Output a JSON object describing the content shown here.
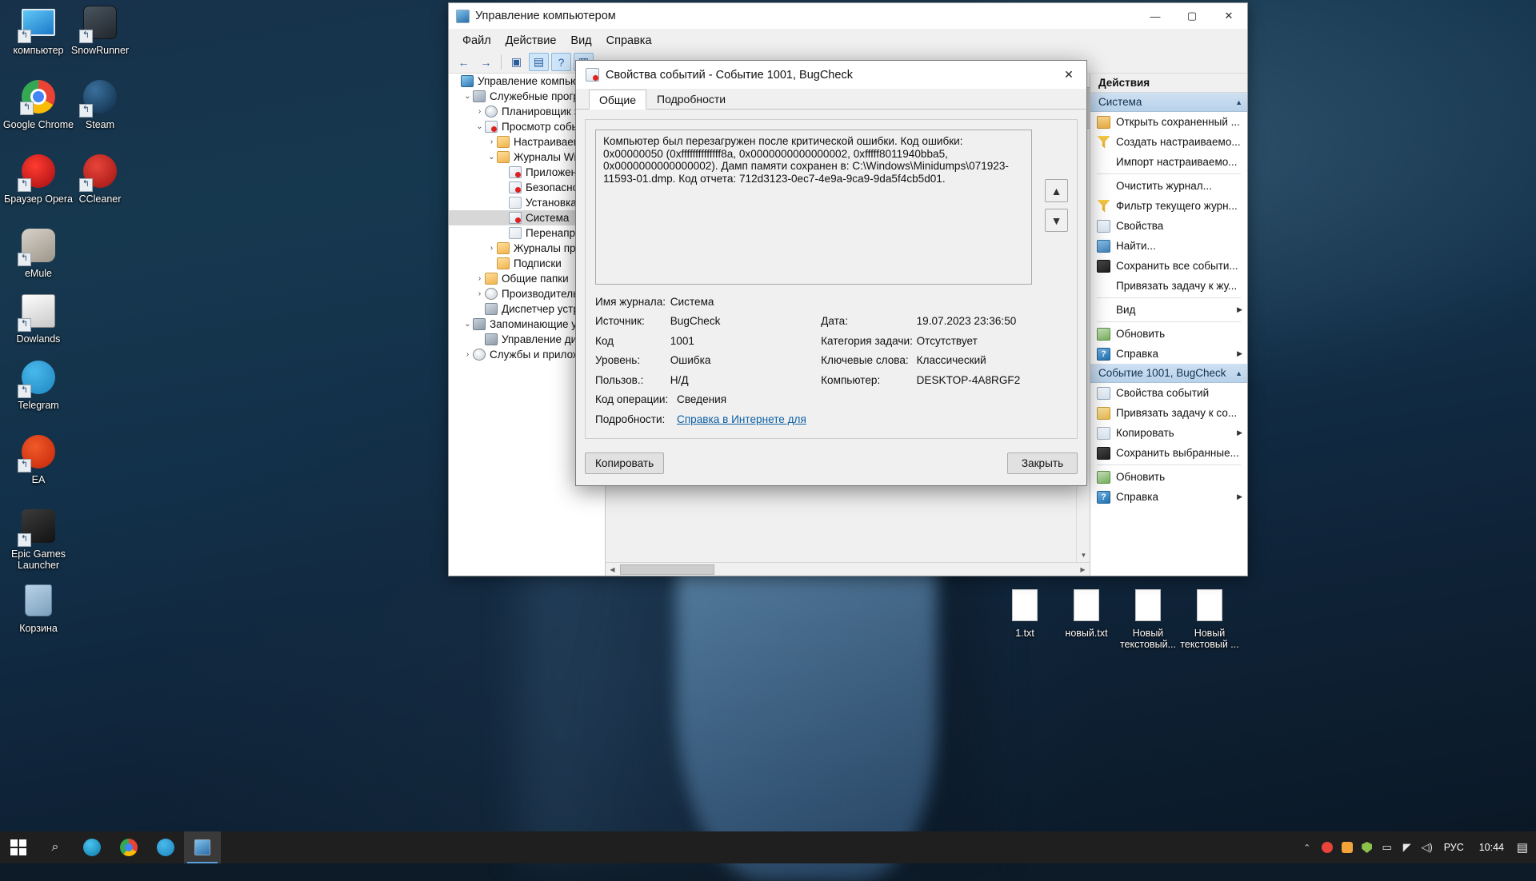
{
  "desktop": {
    "icons": [
      {
        "label": "компьютер",
        "icon": "computer-icon",
        "col": 0,
        "row": 0
      },
      {
        "label": "SnowRunner",
        "icon": "snowrunner-icon",
        "col": 1,
        "row": 0
      },
      {
        "label": "Google Chrome",
        "icon": "chrome-icon",
        "col": 0,
        "row": 1
      },
      {
        "label": "Steam",
        "icon": "steam-icon",
        "col": 1,
        "row": 1
      },
      {
        "label": "Браузер Opera",
        "icon": "opera-icon",
        "col": 0,
        "row": 2
      },
      {
        "label": "CCleaner",
        "icon": "ccleaner-icon",
        "col": 1,
        "row": 2
      },
      {
        "label": "eMule",
        "icon": "emule-icon",
        "col": 0,
        "row": 3
      },
      {
        "label": "Dowlands",
        "icon": "folder-icon",
        "col": 0,
        "row": 4
      },
      {
        "label": "Telegram",
        "icon": "telegram-icon",
        "col": 0,
        "row": 5
      },
      {
        "label": "EA",
        "icon": "ea-icon",
        "col": 0,
        "row": 6
      },
      {
        "label": "Epic Games Launcher",
        "icon": "epic-games-icon",
        "col": 0,
        "row": 7
      },
      {
        "label": "Корзина",
        "icon": "recycle-bin-icon",
        "col": 0,
        "row": 8
      }
    ],
    "files": [
      {
        "label": "1.txt",
        "icon": "text-file-icon"
      },
      {
        "label": "новый.txt",
        "icon": "text-file-icon"
      },
      {
        "label": "Новый текстовый...",
        "icon": "text-file-icon"
      },
      {
        "label": "Новый текстовый ...",
        "icon": "text-file-icon"
      }
    ]
  },
  "computer_management": {
    "title": "Управление компьютером",
    "menu": [
      "Файл",
      "Действие",
      "Вид",
      "Справка"
    ],
    "tree": [
      {
        "label": "Управление компьютером",
        "indent": 0,
        "twisty": "",
        "icon": "computer-mgmt-icon",
        "selected": false
      },
      {
        "label": "Служебные программы",
        "indent": 1,
        "twisty": "⌄",
        "icon": "tools-icon",
        "selected": false
      },
      {
        "label": "Планировщик задач",
        "indent": 2,
        "twisty": "›",
        "icon": "clock-icon",
        "selected": false
      },
      {
        "label": "Просмотр событий",
        "indent": 2,
        "twisty": "⌄",
        "icon": "event-viewer-icon",
        "selected": false
      },
      {
        "label": "Настраиваемые предс",
        "indent": 3,
        "twisty": "›",
        "icon": "custom-views-icon",
        "selected": false
      },
      {
        "label": "Журналы Windows",
        "indent": 3,
        "twisty": "⌄",
        "icon": "windows-logs-icon",
        "selected": false
      },
      {
        "label": "Приложение",
        "indent": 4,
        "twisty": "",
        "icon": "log-icon",
        "selected": false
      },
      {
        "label": "Безопасность",
        "indent": 4,
        "twisty": "",
        "icon": "log-icon",
        "selected": false
      },
      {
        "label": "Установка",
        "indent": 4,
        "twisty": "",
        "icon": "plain-log-icon",
        "selected": false
      },
      {
        "label": "Система",
        "indent": 4,
        "twisty": "",
        "icon": "log-icon",
        "selected": true
      },
      {
        "label": "Перенаправленные",
        "indent": 4,
        "twisty": "",
        "icon": "plain-log-icon",
        "selected": false
      },
      {
        "label": "Журналы приложений",
        "indent": 3,
        "twisty": "›",
        "icon": "app-logs-icon",
        "selected": false
      },
      {
        "label": "Подписки",
        "indent": 3,
        "twisty": "",
        "icon": "subscriptions-icon",
        "selected": false
      },
      {
        "label": "Общие папки",
        "indent": 2,
        "twisty": "›",
        "icon": "shared-folders-icon",
        "selected": false
      },
      {
        "label": "Производительность",
        "indent": 2,
        "twisty": "›",
        "icon": "performance-icon",
        "selected": false
      },
      {
        "label": "Диспетчер устройств",
        "indent": 2,
        "twisty": "",
        "icon": "device-manager-icon",
        "selected": false
      },
      {
        "label": "Запоминающие устрой",
        "indent": 1,
        "twisty": "⌄",
        "icon": "storage-icon",
        "selected": false
      },
      {
        "label": "Управление дисками",
        "indent": 2,
        "twisty": "",
        "icon": "disk-mgmt-icon",
        "selected": false
      },
      {
        "label": "Службы и приложения",
        "indent": 1,
        "twisty": "›",
        "icon": "services-icon",
        "selected": false
      }
    ],
    "detail_rows": [
      {
        "label": "Уровень:",
        "value": "Ошибка",
        "label2": "Ключевые слова:",
        "value2": "Классический"
      },
      {
        "label": "Пользов.:",
        "value": "Н/Д",
        "label2": "Компьютер:",
        "value2": "DESKTOP-4A8RGF2"
      },
      {
        "label": "Код операции:",
        "value": "Сведения",
        "label2": "",
        "value2": ""
      },
      {
        "label": "Подробности:",
        "value": "Справка в Интернете для",
        "label2": "",
        "value2": "",
        "link": true
      }
    ]
  },
  "actions_pane": {
    "title": "Действия",
    "groups": [
      {
        "name": "Система",
        "collapse_icon": "chevron-up-icon",
        "items": [
          {
            "label": "Открыть сохраненный ...",
            "icon": "open-saved-log-icon",
            "submenu": false,
            "sep_after": false
          },
          {
            "label": "Создать настраиваемо...",
            "icon": "create-custom-view-icon",
            "submenu": false,
            "sep_after": false
          },
          {
            "label": "Импорт настраиваемо...",
            "icon": "",
            "submenu": false,
            "sep_after": true
          },
          {
            "label": "Очистить журнал...",
            "icon": "",
            "submenu": false,
            "sep_after": false
          },
          {
            "label": "Фильтр текущего журн...",
            "icon": "filter-icon",
            "submenu": false,
            "sep_after": false
          },
          {
            "label": "Свойства",
            "icon": "properties-icon",
            "submenu": false,
            "sep_after": false
          },
          {
            "label": "Найти...",
            "icon": "find-icon",
            "submenu": false,
            "sep_after": false
          },
          {
            "label": "Сохранить все событи...",
            "icon": "save-icon",
            "submenu": false,
            "sep_after": false
          },
          {
            "label": "Привязать задачу к жу...",
            "icon": "",
            "submenu": false,
            "sep_after": true
          },
          {
            "label": "Вид",
            "icon": "",
            "submenu": true,
            "sep_after": true
          },
          {
            "label": "Обновить",
            "icon": "refresh-icon",
            "submenu": false,
            "sep_after": false
          },
          {
            "label": "Справка",
            "icon": "help-icon",
            "submenu": true,
            "sep_after": false
          }
        ]
      },
      {
        "name": "Событие 1001, BugCheck",
        "collapse_icon": "chevron-up-icon",
        "items": [
          {
            "label": "Свойства событий",
            "icon": "properties-icon",
            "submenu": false,
            "sep_after": false
          },
          {
            "label": "Привязать задачу к со...",
            "icon": "attach-task-icon",
            "submenu": false,
            "sep_after": false
          },
          {
            "label": "Копировать",
            "icon": "copy-icon",
            "submenu": true,
            "sep_after": false
          },
          {
            "label": "Сохранить выбранные...",
            "icon": "save-icon",
            "submenu": false,
            "sep_after": true
          },
          {
            "label": "Обновить",
            "icon": "refresh-icon",
            "submenu": false,
            "sep_after": false
          },
          {
            "label": "Справка",
            "icon": "help-icon",
            "submenu": true,
            "sep_after": false
          }
        ]
      }
    ]
  },
  "event_dialog": {
    "title": "Свойства событий - Событие 1001, BugCheck",
    "tabs": [
      {
        "label": "Общие",
        "active": true
      },
      {
        "label": "Подробности",
        "active": false
      }
    ],
    "message": "Компьютер был перезагружен после критической ошибки.  Код ошибки: 0x00000050 (0xffffffffffffff8a, 0x0000000000000002, 0xfffff8011940bba5, 0x0000000000000002). Дамп памяти сохранен в: C:\\Windows\\Minidumps\\071923-11593-01.dmp. Код отчета: 712d3123-0ec7-4e9a-9ca9-9da5f4cb5d01.",
    "fields": [
      {
        "label": "Имя журнала:",
        "value": "Система",
        "label2": "",
        "value2": ""
      },
      {
        "label": "Источник:",
        "value": "BugCheck",
        "label2": "Дата:",
        "value2": "19.07.2023 23:36:50"
      },
      {
        "label": "Код",
        "value": "1001",
        "label2": "Категория задачи:",
        "value2": "Отсутствует"
      },
      {
        "label": "Уровень:",
        "value": "Ошибка",
        "label2": "Ключевые слова:",
        "value2": "Классический"
      },
      {
        "label": "Пользов.:",
        "value": "Н/Д",
        "label2": "Компьютер:",
        "value2": "DESKTOP-4A8RGF2"
      },
      {
        "label": "Код операции:",
        "value": "Сведения",
        "label2": "",
        "value2": ""
      },
      {
        "label": "Подробности:",
        "value": "Справка в Интернете для ",
        "label2": "",
        "value2": "",
        "link": true
      }
    ],
    "nav_up": "▲",
    "nav_down": "▼",
    "copy_button": "Копировать",
    "close_button": "Закрыть"
  },
  "taskbar": {
    "start_icon": "windows-start-icon",
    "items": [
      {
        "icon": "search-icon",
        "name": "search-taskbar-button",
        "open": false,
        "active": false
      },
      {
        "icon": "edge-icon",
        "name": "edge-taskbar-button",
        "open": false,
        "active": false
      },
      {
        "icon": "chrome-icon",
        "name": "chrome-taskbar-button",
        "open": false,
        "active": false
      },
      {
        "icon": "telegram-icon",
        "name": "telegram-taskbar-button",
        "open": false,
        "active": false
      },
      {
        "icon": "computer-mgmt-icon",
        "name": "computer-management-taskbar-button",
        "open": true,
        "active": true
      }
    ],
    "tray_icons": [
      "opera-tray-icon",
      "updates-tray-icon",
      "shield-tray-icon",
      "battery-tray-icon",
      "network-tray-icon",
      "volume-tray-icon"
    ],
    "language": "РУС",
    "time": "10:44",
    "notifications_icon": "notifications-icon"
  }
}
